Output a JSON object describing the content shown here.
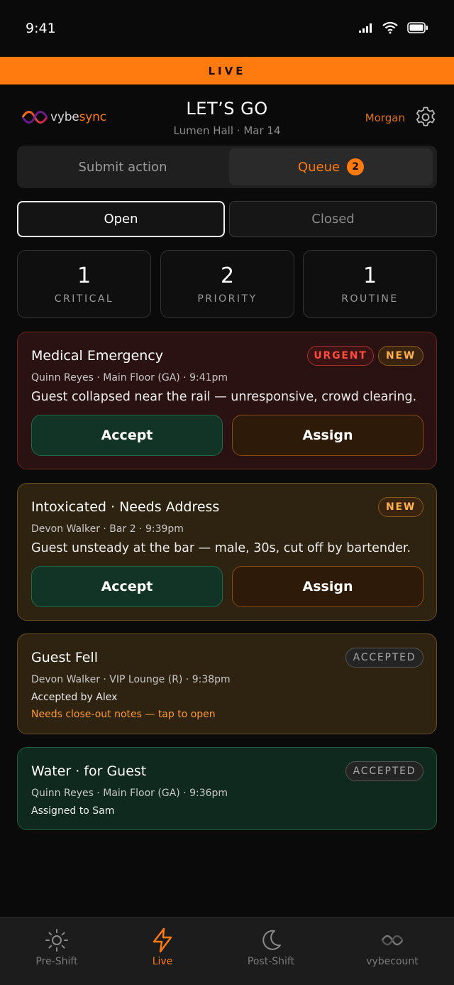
{
  "status": {
    "time": "9:41"
  },
  "banner": {
    "label": "LIVE"
  },
  "header": {
    "logo_prefix": "vybe",
    "logo_accent": "sync",
    "title": "LET’S GO",
    "subtitle": "Lumen Hall · Mar 14",
    "user": "Morgan"
  },
  "segmented": {
    "submit_label": "Submit action",
    "queue_label": "Queue",
    "queue_count": "2"
  },
  "filters": {
    "open_label": "Open",
    "closed_label": "Closed"
  },
  "stats": [
    {
      "value": "1",
      "label": "CRITICAL"
    },
    {
      "value": "2",
      "label": "PRIORITY"
    },
    {
      "value": "1",
      "label": "ROUTINE"
    }
  ],
  "cards": [
    {
      "title": "Medical Emergency",
      "meta": "Quinn Reyes · Main Floor (GA) · 9:41pm",
      "desc": "Guest collapsed near the rail — unresponsive, crowd clearing.",
      "badge_urgent": "URGENT",
      "badge_new": "NEW",
      "accept": "Accept",
      "assign": "Assign"
    },
    {
      "title": "Intoxicated · Needs Address",
      "meta": "Devon Walker · Bar 2 · 9:39pm",
      "desc": "Guest unsteady at the bar — male, 30s, cut off by bartender.",
      "badge_new": "NEW",
      "accept": "Accept",
      "assign": "Assign"
    },
    {
      "title": "Guest Fell",
      "meta": "Devon Walker · VIP Lounge (R) · 9:38pm",
      "line": "Accepted by Alex",
      "link": "Needs close-out notes — tap to open",
      "badge": "ACCEPTED"
    },
    {
      "title": "Water · for Guest",
      "meta": "Quinn Reyes · Main Floor (GA) · 9:36pm",
      "line": "Assigned to Sam",
      "badge": "ACCEPTED"
    }
  ],
  "tabs": [
    {
      "label": "Pre-Shift",
      "icon": "sun-icon"
    },
    {
      "label": "Live",
      "icon": "lightning-icon",
      "active": true
    },
    {
      "label": "Post-Shift",
      "icon": "moon-icon"
    },
    {
      "label": "vybecount",
      "icon": "vybe-logo-icon"
    }
  ],
  "colors": {
    "accent": "#ff7a0f",
    "critical": "#ff4a3d",
    "accept": "#1f6b49"
  }
}
